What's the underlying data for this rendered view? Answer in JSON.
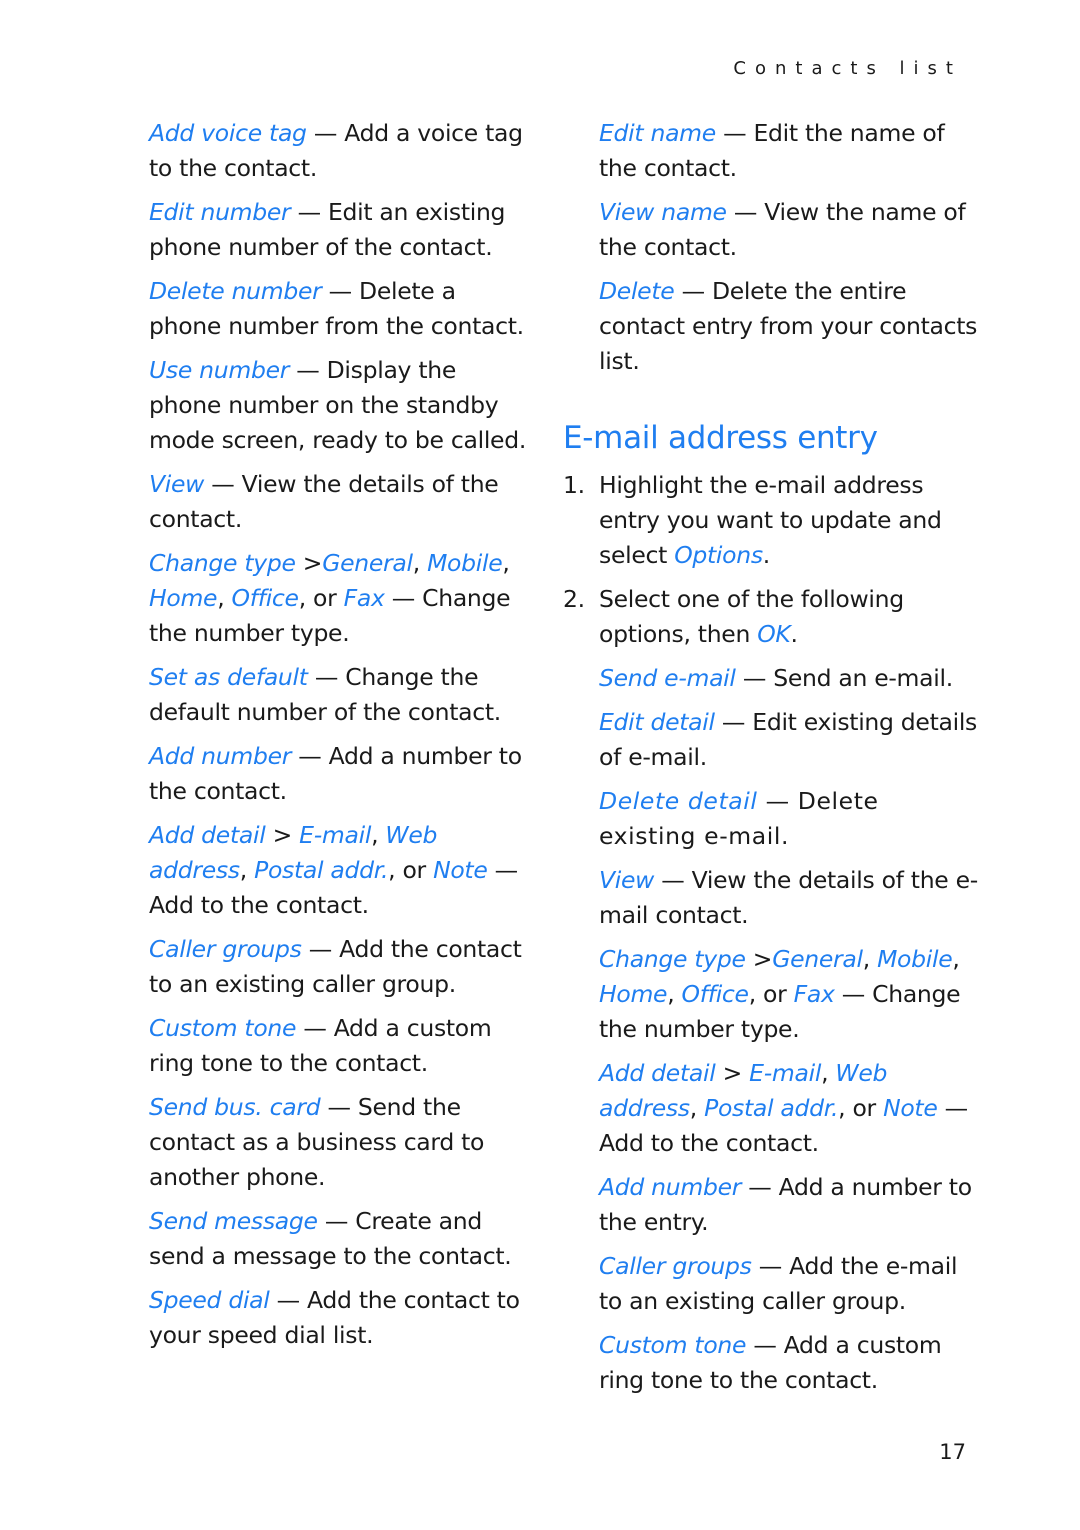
{
  "header": {
    "running_title": "Contacts list"
  },
  "colors": {
    "accent": "#1f7ef0",
    "text": "#1a1a1a"
  },
  "left_column": [
    {
      "term": "Add voice tag",
      "desc": " — Add a voice tag to the contact."
    },
    {
      "term": "Edit number",
      "desc": " — Edit an existing phone number of the contact."
    },
    {
      "term": "Delete number",
      "desc": " — Delete a phone number from the contact."
    },
    {
      "term": "Use number",
      "desc": " — Display the phone number on the standby mode screen, ready to be called."
    },
    {
      "term": "View",
      "desc": " — View the details of the contact."
    },
    {
      "term": "Change type",
      "sep": " >",
      "opt1": "General",
      "c1": ", ",
      "opt2": "Mobile",
      "c2": ", ",
      "opt3": "Home",
      "c3": ", ",
      "opt4": "Office",
      "c4": ", or ",
      "opt5": "Fax",
      "desc": " — Change the number type."
    },
    {
      "term": "Set as default",
      "desc": " — Change the default number of the contact."
    },
    {
      "term": "Add number",
      "desc": " — Add a number to the contact."
    },
    {
      "term": "Add detail",
      "sep": " > ",
      "opt1": "E-mail",
      "c1": ", ",
      "opt2": "Web address",
      "c2": ", ",
      "opt3": "Postal addr.",
      "c3": ", or ",
      "opt4": "Note",
      "desc": " — Add to the contact."
    },
    {
      "term": "Caller groups",
      "desc": " — Add the contact to an existing caller group."
    },
    {
      "term": "Custom tone",
      "desc": " — Add a custom ring tone to the contact."
    },
    {
      "term": "Send bus. card",
      "desc": " — Send the contact as a business card to another phone."
    },
    {
      "term": "Send message",
      "desc": " — Create and send a message to the contact."
    },
    {
      "term": "Speed dial",
      "desc": " — Add the contact to your speed dial list."
    }
  ],
  "right_column_top": [
    {
      "term": "Edit name",
      "desc": " — Edit the name of the contact."
    },
    {
      "term": "View name",
      "desc": " — View the name of the contact."
    },
    {
      "term": "Delete",
      "desc": " — Delete the entire contact entry from your contacts list."
    }
  ],
  "section": {
    "title": "E-mail address entry",
    "steps": [
      {
        "num": "1.",
        "text": "Highlight the e-mail address entry you want to update and select ",
        "link": "Options",
        "end": "."
      },
      {
        "num": "2.",
        "text": "Select one of the following options, then ",
        "link": "OK",
        "end": "."
      }
    ],
    "options": [
      {
        "term": "Send e-mail",
        "desc": " — Send an e-mail."
      },
      {
        "term": "Edit detail",
        "desc": " — Edit existing details of e-mail."
      },
      {
        "term": "Delete detail",
        "desc": " — Delete existing e-mail."
      },
      {
        "term": "View",
        "desc": " — View the details of the e-mail contact."
      },
      {
        "term": "Change type",
        "sep": " >",
        "opt1": "General",
        "c1": ", ",
        "opt2": "Mobile",
        "c2": ", ",
        "opt3": "Home",
        "c3": ", ",
        "opt4": "Office",
        "c4": ", or ",
        "opt5": "Fax",
        "desc": " — Change the number type."
      },
      {
        "term": "Add detail",
        "sep": " > ",
        "opt1": "E-mail",
        "c1": ", ",
        "opt2": "Web address",
        "c2": ", ",
        "opt3": "Postal addr.",
        "c3": ", or ",
        "opt4": "Note",
        "desc": " — Add to the contact."
      },
      {
        "term": "Add number",
        "desc": " — Add a number to the entry."
      },
      {
        "term": "Caller groups",
        "desc": " — Add the e-mail to an existing caller group."
      },
      {
        "term": "Custom tone",
        "desc": " — Add a custom ring tone to the contact."
      }
    ]
  },
  "footer": {
    "page_number": "17"
  }
}
